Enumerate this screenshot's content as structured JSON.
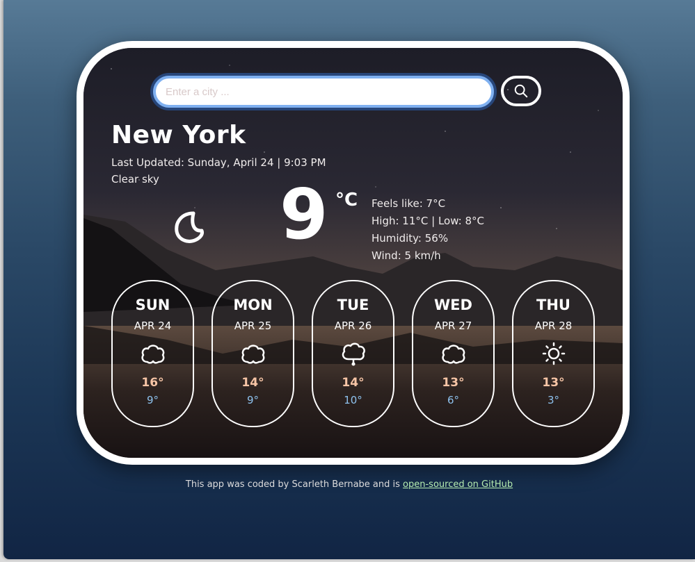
{
  "search": {
    "placeholder": "Enter a city ...",
    "button_icon": "search-icon"
  },
  "current": {
    "city": "New York",
    "last_updated": "Last Updated: Sunday, April 24 | 9:03 PM",
    "description": "Clear sky",
    "icon": "moon-icon",
    "temperature": "9",
    "unit": "°C",
    "feels_like": "Feels like: 7°C",
    "high_low": "High: 11°C | Low: 8°C",
    "humidity": "Humidity: 56%",
    "wind": "Wind: 5 km/h"
  },
  "forecast": [
    {
      "day": "SUN",
      "date": "APR 24",
      "icon": "cloud-icon",
      "high": "16°",
      "low": "9°"
    },
    {
      "day": "MON",
      "date": "APR 25",
      "icon": "cloud-icon",
      "high": "14°",
      "low": "9°"
    },
    {
      "day": "TUE",
      "date": "APR 26",
      "icon": "cloud-drizzle-icon",
      "high": "14°",
      "low": "10°"
    },
    {
      "day": "WED",
      "date": "APR 27",
      "icon": "cloud-icon",
      "high": "13°",
      "low": "6°"
    },
    {
      "day": "THU",
      "date": "APR 28",
      "icon": "sun-icon",
      "high": "13°",
      "low": "3°"
    }
  ],
  "footer": {
    "text": "This app was coded by Scarleth Bernabe and is ",
    "link_text": "open-sourced on GitHub"
  },
  "colors": {
    "high_temp": "#f7c5a6",
    "low_temp": "#8ec2ee",
    "input_border": "#7fb0f0",
    "link": "#b5ecb0"
  }
}
